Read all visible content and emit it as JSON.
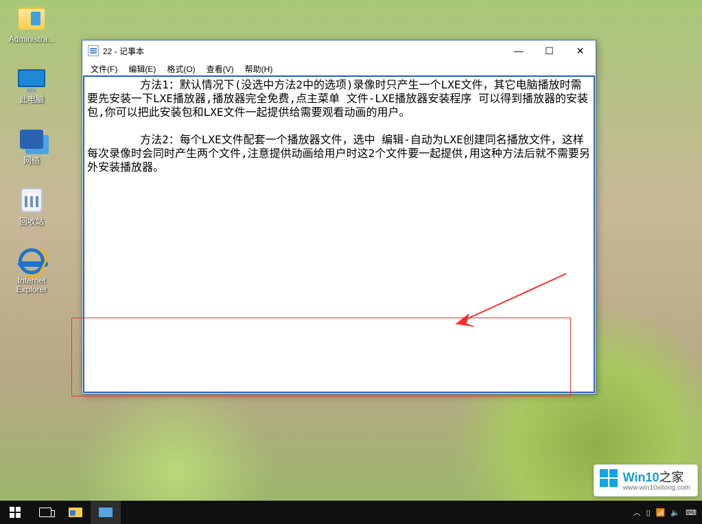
{
  "desktop": {
    "icons": [
      {
        "name": "Administra..."
      },
      {
        "name": "此电脑"
      },
      {
        "name": "网络"
      },
      {
        "name": "回收站"
      },
      {
        "name": "Internet Explorer"
      }
    ]
  },
  "notepad": {
    "title": "22 - 记事本",
    "menu": {
      "file": "文件(F)",
      "edit": "编辑(E)",
      "format": "格式(O)",
      "view": "查看(V)",
      "help": "帮助(H)"
    },
    "content": "        方法1：默认情况下(没选中方法2中的选项)录像时只产生一个LXE文件，其它电脑播放时需要先安装一下LXE播放器,播放器完全免费,点主菜单 文件-LXE播放器安装程序 可以得到播放器的安装包,你可以把此安装包和LXE文件一起提供给需要观看动画的用户。\n\n        方法2：每个LXE文件配套一个播放器文件，选中 编辑-自动为LXE创建同名播放文件，这样每次录像时会同时产生两个文件,注意提供动画给用户时这2个文件要一起提供,用这种方法后就不需要另外安装播放器。"
  },
  "window_controls": {
    "minimize": "—",
    "maximize": "☐",
    "close": "✕"
  },
  "watermark": {
    "brand_a": "Win10",
    "brand_b": "之家",
    "url": "www.win10xitong.com"
  },
  "taskbar": {
    "chevron": "︿",
    "battery": "▯",
    "speaker": "🔈",
    "keyboard": "⌨",
    "network": "📶"
  }
}
